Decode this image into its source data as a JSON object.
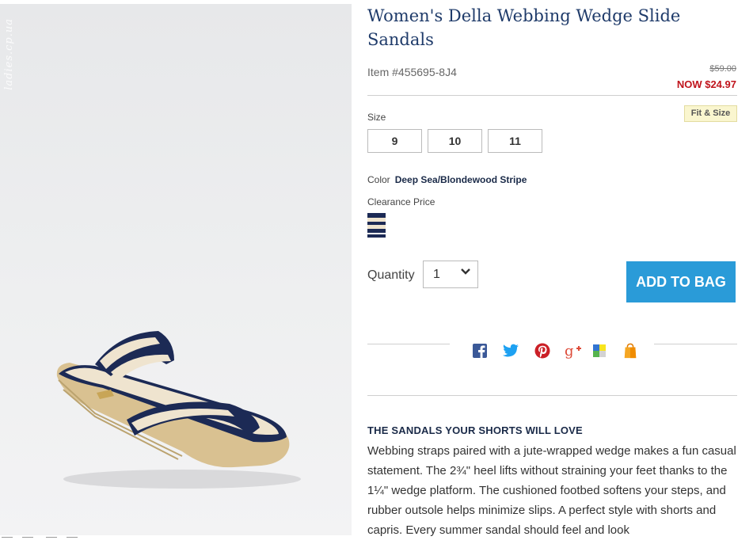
{
  "product": {
    "title": "Women's Della Webbing Wedge Slide Sandals",
    "item_number": "Item #455695-8J4",
    "was_price": "$59.00",
    "now_price": "NOW $24.97"
  },
  "photo": {
    "watermark": "ladies.cp.ua"
  },
  "size": {
    "label": "Size",
    "options": [
      "9",
      "10",
      "11"
    ],
    "fit_label": "Fit & Size"
  },
  "color": {
    "label": "Color",
    "value": "Deep Sea/Blondewood Stripe",
    "price_note": "Clearance Price"
  },
  "quantity": {
    "label": "Quantity",
    "value": "1"
  },
  "cart": {
    "add_label": "ADD TO BAG"
  },
  "share": {
    "icons": [
      "facebook-icon",
      "twitter-icon",
      "pinterest-icon",
      "google-plus-icon",
      "delicious-icon",
      "shopping-bag-icon"
    ]
  },
  "description": {
    "heading": "THE SANDALS YOUR SHORTS WILL LOVE",
    "body": "Webbing straps paired with a jute-wrapped wedge makes a fun casual statement. The 2¾\" heel lifts without straining your feet thanks to the 1¼\" wedge platform. The cushioned footbed softens your steps, and rubber outsole helps minimize slips. A perfect style with shorts and capris. Every summer sandal should feel and look"
  },
  "colors": {
    "title": "#1f3b6a",
    "sale": "#c0141c",
    "button": "#2a9bd8",
    "navy": "#1c2a55",
    "cream": "#efe4cf"
  }
}
